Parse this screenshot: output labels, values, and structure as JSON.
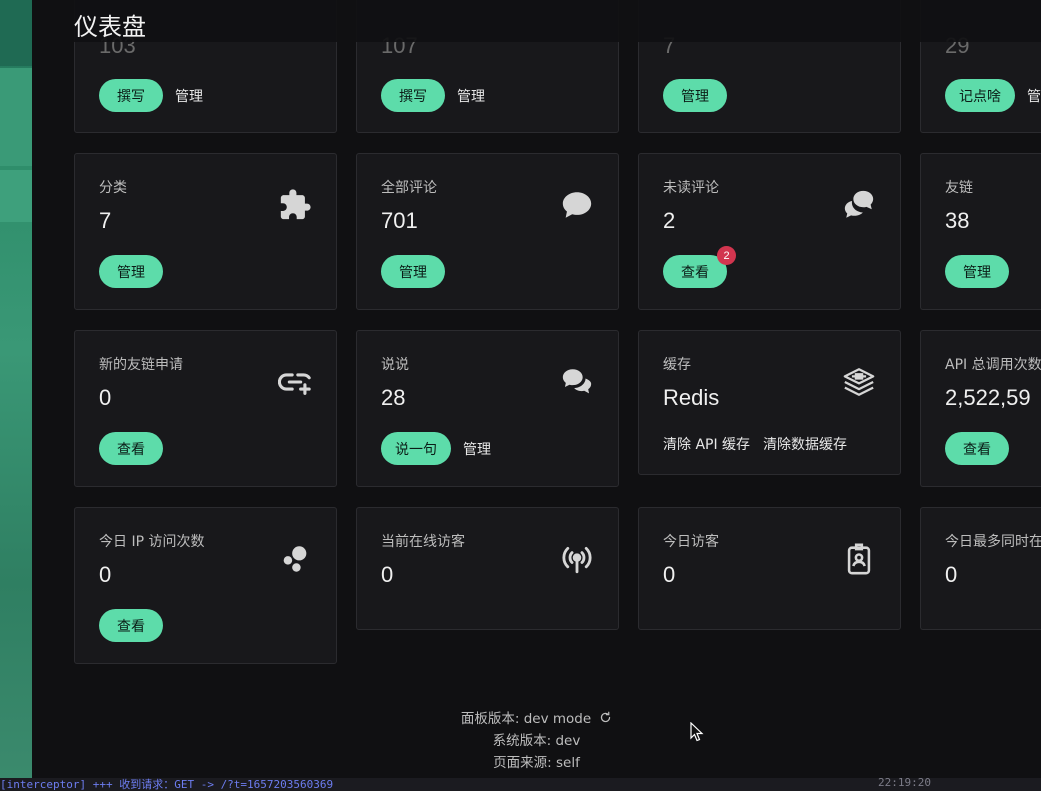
{
  "header": {
    "title": "仪表盘"
  },
  "top_row": [
    {
      "value": "103",
      "actions": [
        {
          "type": "button",
          "label": "撰写"
        },
        {
          "type": "link",
          "label": "管理"
        }
      ]
    },
    {
      "value": "107",
      "actions": [
        {
          "type": "button",
          "label": "撰写"
        },
        {
          "type": "link",
          "label": "管理"
        }
      ]
    },
    {
      "value": "7",
      "actions": [
        {
          "type": "button",
          "label": "管理"
        }
      ]
    },
    {
      "value": "29",
      "actions": [
        {
          "type": "button",
          "label": "记点啥"
        },
        {
          "type": "link",
          "label": "管"
        }
      ]
    }
  ],
  "cards": {
    "category": {
      "label": "分类",
      "value": "7",
      "icon": "puzzle-icon",
      "button": "管理"
    },
    "all_comments": {
      "label": "全部评论",
      "value": "701",
      "icon": "comment-icon",
      "button": "管理"
    },
    "unread_comments": {
      "label": "未读评论",
      "value": "2",
      "icon": "comments-icon",
      "button": "查看",
      "badge": "2"
    },
    "friend_links": {
      "label": "友链",
      "value": "38",
      "button": "管理"
    },
    "new_link_requests": {
      "label": "新的友链申请",
      "value": "0",
      "icon": "link-add-icon",
      "button": "查看"
    },
    "says": {
      "label": "说说",
      "value": "28",
      "icon": "chat-bubbles-icon",
      "button": "说一句",
      "link": "管理"
    },
    "cache": {
      "label": "缓存",
      "value": "Redis",
      "icon": "layers-icon",
      "link1": "清除 API 缓存",
      "link2": "清除数据缓存"
    },
    "api_calls": {
      "label": "API 总调用次数",
      "value": "2,522,59",
      "button": "查看"
    },
    "today_ip": {
      "label": "今日 IP 访问次数",
      "value": "0",
      "icon": "bubbles-icon",
      "button": "查看"
    },
    "online_visitors": {
      "label": "当前在线访客",
      "value": "0",
      "icon": "broadcast-icon"
    },
    "today_visitors": {
      "label": "今日访客",
      "value": "0",
      "icon": "badge-id-icon"
    },
    "max_concurrent": {
      "label": "今日最多同时在",
      "value": "0"
    }
  },
  "footer": {
    "panel_version": "面板版本: dev mode",
    "system_version": "系统版本: dev",
    "page_source": "页面来源: self"
  },
  "console": {
    "text": "[interceptor] +++ 收到请求：GET -> /?t=1657203560369",
    "time": "22:19:20"
  },
  "colors": {
    "accent": "#5ddcaa",
    "badge": "#d2354f",
    "card_bg": "#18181b",
    "page_bg": "#101012"
  }
}
